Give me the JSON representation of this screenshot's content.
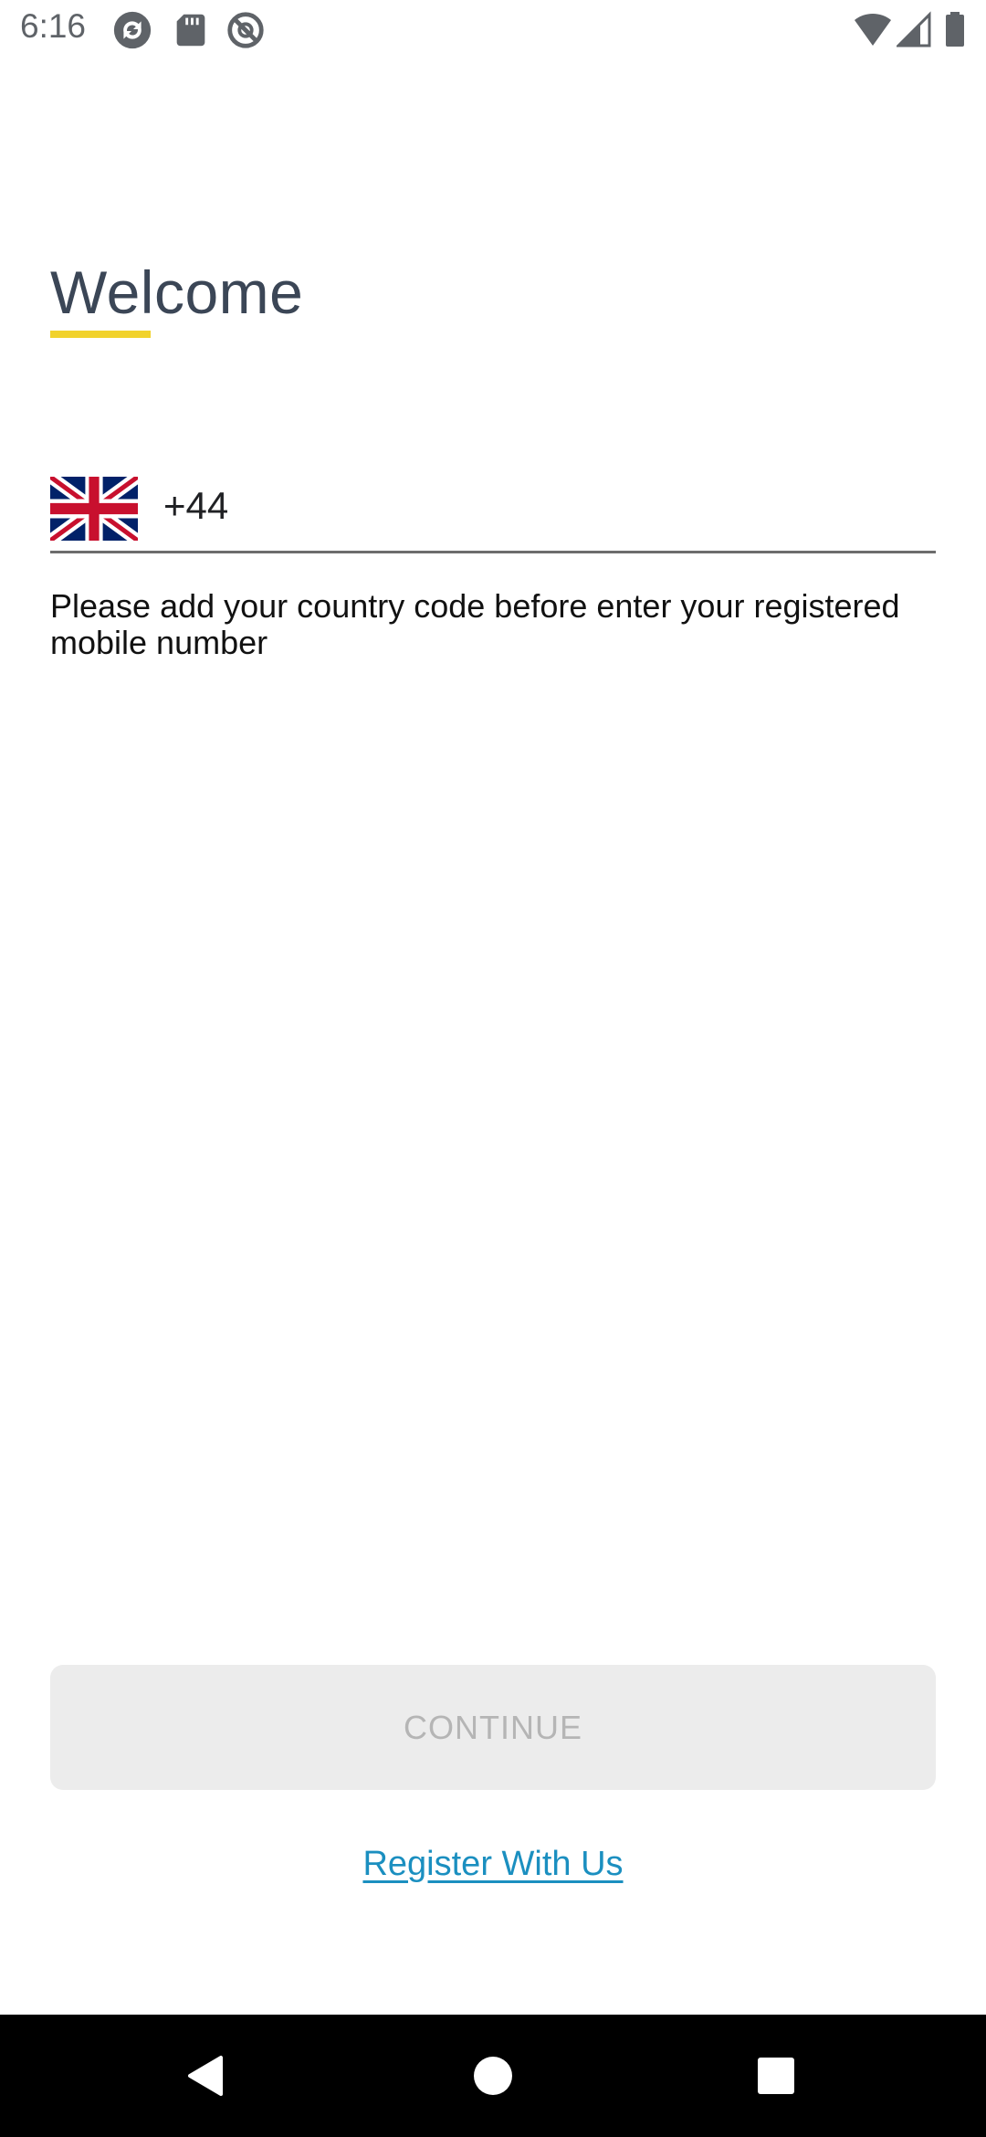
{
  "status_bar": {
    "time": "6:16",
    "left_icons": [
      "sync-icon",
      "sd-card-icon",
      "do-not-disturb-icon"
    ],
    "right_icons": [
      "wifi-icon",
      "cellular-signal-icon",
      "battery-icon"
    ]
  },
  "screen": {
    "title": "Welcome",
    "accent_color": "#f1d22c",
    "phone_field": {
      "flag": "uk-flag-icon",
      "country_code": "+44"
    },
    "helper_text": "Please add your country code before enter your registered mobile number",
    "continue_label": "CONTINUE",
    "register_label": "Register With Us",
    "link_color": "#1b8fc0"
  },
  "nav_bar": {
    "buttons": [
      "back-icon",
      "home-icon",
      "recents-icon"
    ]
  }
}
